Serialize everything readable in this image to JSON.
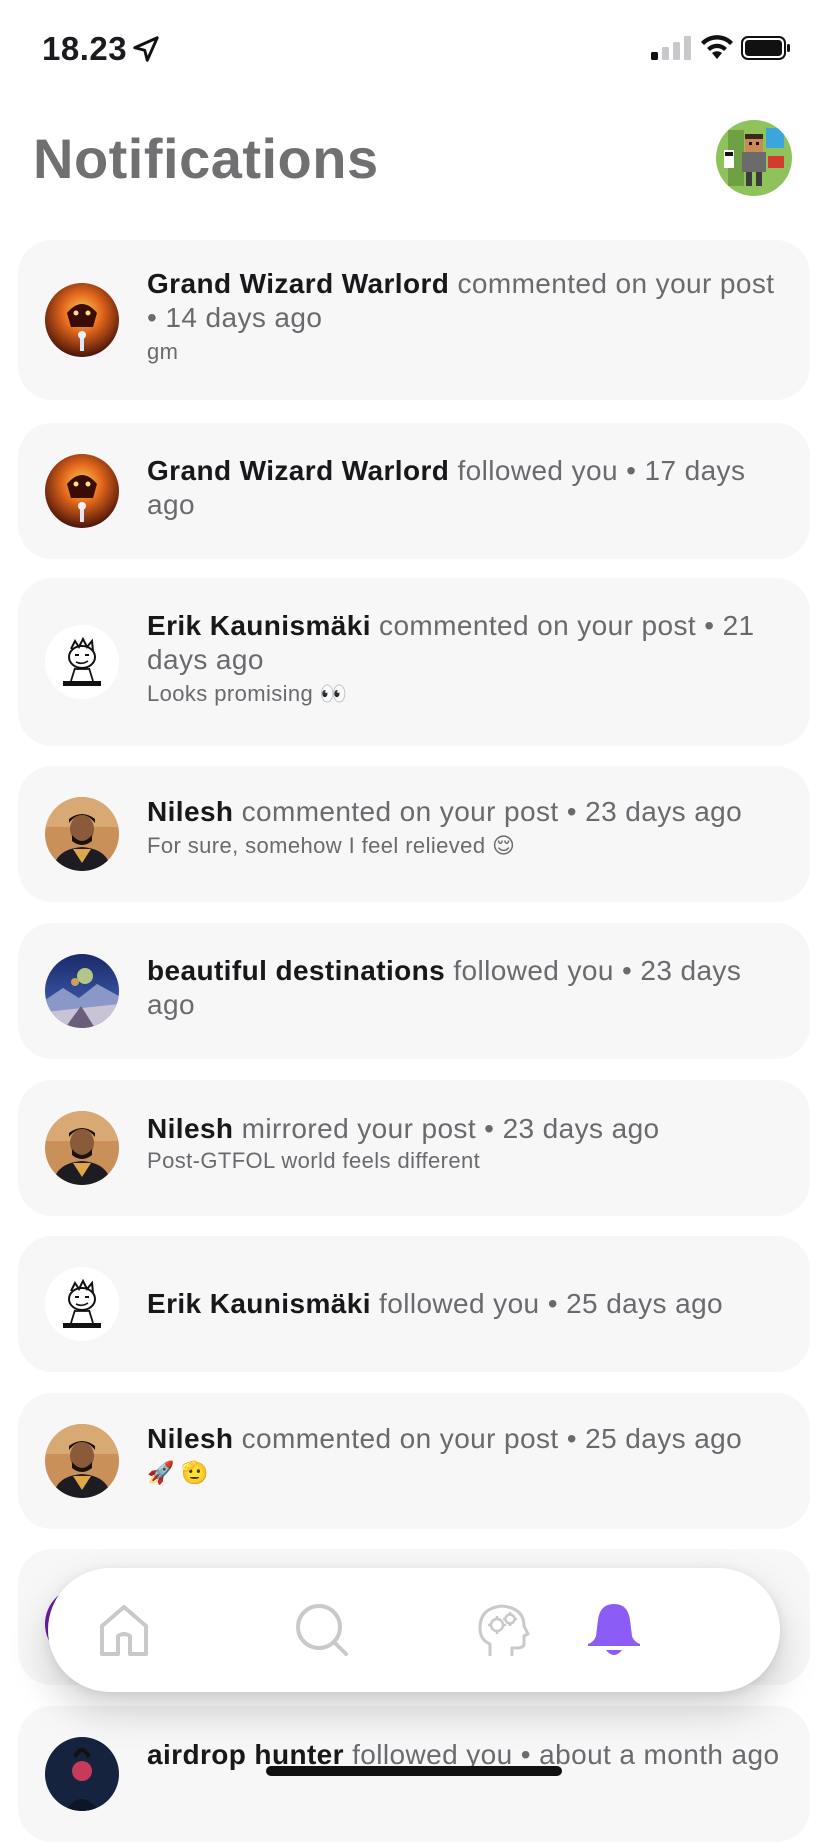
{
  "status_bar": {
    "time": "18.23",
    "icons": [
      "location-arrow-icon",
      "cellular-signal-icon",
      "wifi-icon",
      "battery-icon"
    ]
  },
  "header": {
    "title": "Notifications",
    "profile_avatar": "pixel-art-avatar"
  },
  "notifications": [
    {
      "user": "Grand Wizard Warlord",
      "action": " commented on your post • 14 days ago",
      "preview": "gm",
      "avatar": "fire-demon-avatar"
    },
    {
      "user": "Grand Wizard Warlord",
      "action": " followed you • 17 days ago",
      "preview": "",
      "avatar": "fire-demon-avatar"
    },
    {
      "user": "Erik Kaunismäki",
      "action": " commented on your post • 21 days ago",
      "preview": "Looks promising 👀",
      "avatar": "sketch-face-avatar"
    },
    {
      "user": "Nilesh",
      "action": " commented on your post • 23 days ago",
      "preview": "For sure, somehow I feel relieved 😌",
      "avatar": "person-photo-avatar"
    },
    {
      "user": "beautiful destinations",
      "action": " followed you • 23 days ago",
      "preview": "",
      "avatar": "landscape-avatar"
    },
    {
      "user": "Nilesh",
      "action": " mirrored your post • 23 days ago",
      "preview": "Post-GTFOL world feels different",
      "avatar": "person-photo-avatar"
    },
    {
      "user": "Erik Kaunismäki",
      "action": " followed you • 25 days ago",
      "preview": "",
      "avatar": "sketch-face-avatar"
    },
    {
      "user": "Nilesh",
      "action": " commented on your post • 25 days ago",
      "preview": "🚀 🫡",
      "avatar": "person-photo-avatar"
    },
    {
      "user": "airdrop hunter",
      "action": " followed you • about a month ago",
      "preview": "",
      "avatar": "dark-illustration-avatar"
    }
  ],
  "bottom_nav": {
    "items": [
      {
        "name": "home",
        "icon": "home-icon",
        "active": false
      },
      {
        "name": "search",
        "icon": "search-icon",
        "active": false
      },
      {
        "name": "ai",
        "icon": "brain-gears-icon",
        "active": false
      },
      {
        "name": "notifications",
        "icon": "bell-icon",
        "active": true
      }
    ],
    "active_color": "#8b5cf6",
    "inactive_color": "#c9c9cc"
  }
}
